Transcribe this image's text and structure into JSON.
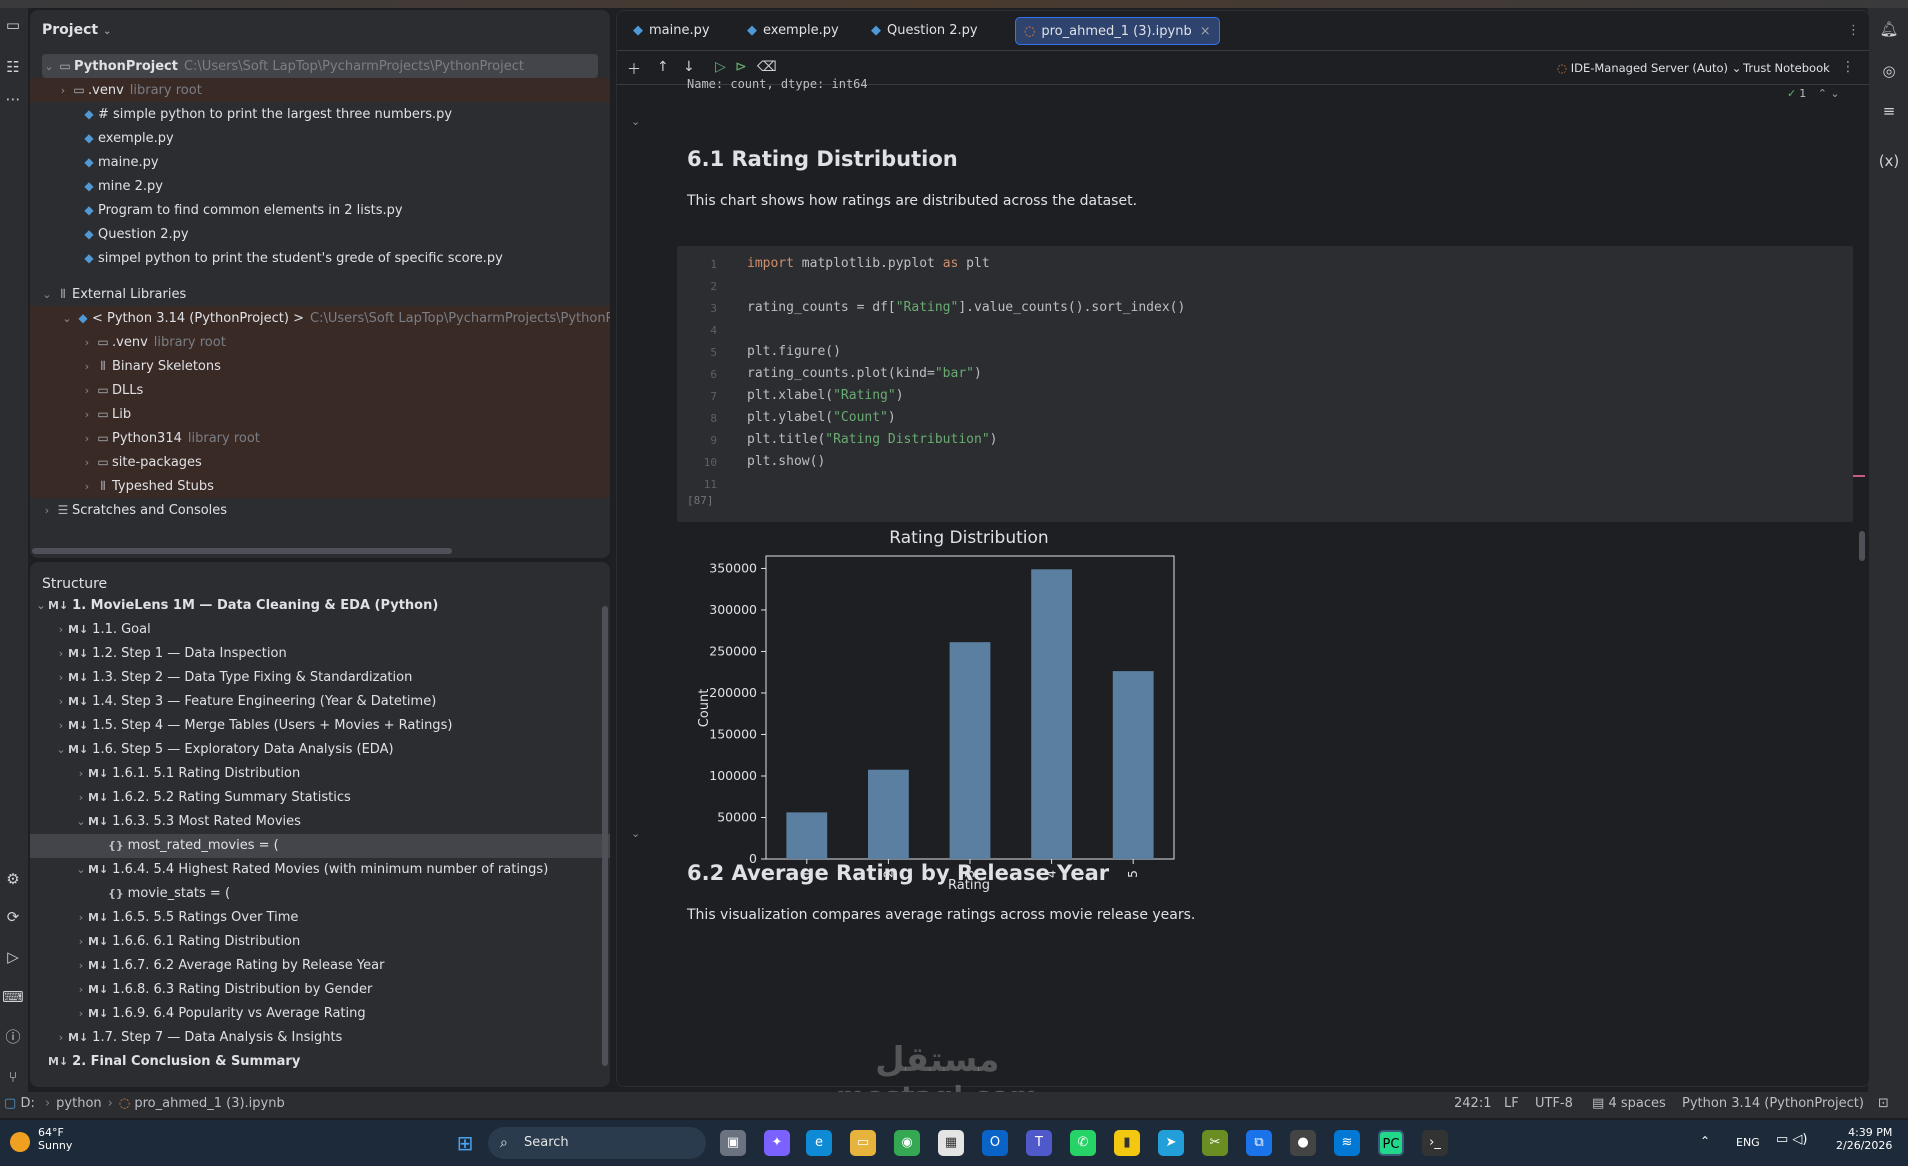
{
  "project_panel": {
    "title": "Project",
    "root": {
      "name": "PythonProject",
      "path": "C:\\Users\\Soft LapTop\\PycharmProjects\\PythonProject"
    },
    "venv": {
      "name": ".venv",
      "tag": "library root"
    },
    "files": [
      "# simple python to print the largest three numbers.py",
      "exemple.py",
      "maine.py",
      "mine 2.py",
      "Program to find common elements in 2 lists.py",
      "Question 2.py",
      "simpel python to print the student's grede of specific score.py"
    ],
    "external_libraries": "External Libraries",
    "python_sdk": {
      "name": "< Python 3.14 (PythonProject) >",
      "path": "C:\\Users\\Soft LapTop\\PycharmProjects\\PythonP"
    },
    "sdk_children": [
      {
        "name": ".venv",
        "tag": "library root"
      },
      {
        "name": "Binary Skeletons",
        "tag": ""
      },
      {
        "name": "DLLs",
        "tag": ""
      },
      {
        "name": "Lib",
        "tag": ""
      },
      {
        "name": "Python314",
        "tag": "library root"
      },
      {
        "name": "site-packages",
        "tag": ""
      },
      {
        "name": "Typeshed Stubs",
        "tag": ""
      }
    ],
    "scratches": "Scratches and Consoles"
  },
  "structure_panel": {
    "title": "Structure",
    "items": [
      {
        "label": "1. MovieLens 1M — Data Cleaning & EDA (Python)",
        "level": 0,
        "open": true
      },
      {
        "label": "1.1. Goal",
        "level": 1,
        "open": false
      },
      {
        "label": "1.2. Step 1 — Data Inspection",
        "level": 1,
        "open": false
      },
      {
        "label": "1.3. Step 2 — Data Type Fixing & Standardization",
        "level": 1,
        "open": false
      },
      {
        "label": "1.4. Step 3 — Feature Engineering (Year & Datetime)",
        "level": 1,
        "open": false
      },
      {
        "label": "1.5. Step 4 — Merge Tables (Users + Movies + Ratings)",
        "level": 1,
        "open": false
      },
      {
        "label": "1.6. Step 5 — Exploratory Data Analysis (EDA)",
        "level": 1,
        "open": true
      },
      {
        "label": "1.6.1. 5.1 Rating Distribution",
        "level": 2,
        "open": false
      },
      {
        "label": "1.6.2. 5.2 Rating Summary Statistics",
        "level": 2,
        "open": false
      },
      {
        "label": "1.6.3. 5.3 Most Rated Movies",
        "level": 2,
        "open": true
      },
      {
        "label": "most_rated_movies = (",
        "level": 3,
        "code": true
      },
      {
        "label": "1.6.4. 5.4 Highest Rated Movies (with minimum number of ratings)",
        "level": 2,
        "open": true
      },
      {
        "label": "movie_stats = (",
        "level": 3,
        "code": true
      },
      {
        "label": "1.6.5. 5.5 Ratings Over Time",
        "level": 2,
        "open": false
      },
      {
        "label": "1.6.6. 6.1 Rating Distribution",
        "level": 2,
        "open": false
      },
      {
        "label": "1.6.7. 6.2 Average Rating by Release Year",
        "level": 2,
        "open": false
      },
      {
        "label": "1.6.8. 6.3 Rating Distribution by Gender",
        "level": 2,
        "open": false
      },
      {
        "label": "1.6.9. 6.4 Popularity vs Average Rating",
        "level": 2,
        "open": false
      },
      {
        "label": "1.7. Step 7 — Data Analysis & Insights",
        "level": 1,
        "open": false
      },
      {
        "label": "2. Final Conclusion & Summary",
        "level": 0,
        "open": null
      }
    ],
    "md_badge": "M↓"
  },
  "tabs": [
    {
      "label": "maine.py",
      "active": false
    },
    {
      "label": "exemple.py",
      "active": false
    },
    {
      "label": "Question 2.py",
      "active": false
    },
    {
      "label": "pro_ahmed_1 (3).ipynb",
      "active": true
    }
  ],
  "toolbar": {
    "server": "IDE-Managed Server (Auto)",
    "trust": "Trust Notebook",
    "check_count": "1"
  },
  "notebook": {
    "prev_output": "Name: count, dtype: int64",
    "section1_title": "6.1 Rating Distribution",
    "section1_text": "This chart shows how ratings are distributed across the dataset.",
    "code_lines": [
      "import matplotlib.pyplot as plt",
      "",
      "rating_counts = df[\"Rating\"].value_counts().sort_index()",
      "",
      "plt.figure()",
      "rating_counts.plot(kind=\"bar\")",
      "plt.xlabel(\"Rating\")",
      "plt.ylabel(\"Count\")",
      "plt.title(\"Rating Distribution\")",
      "plt.show()",
      ""
    ],
    "exec_count": "[87]",
    "section2_title": "6.2 Average Rating by Release Year",
    "section2_text": "This visualization compares average ratings across movie release years."
  },
  "chart_data": {
    "type": "bar",
    "title": "Rating Distribution",
    "xlabel": "Rating",
    "ylabel": "Count",
    "categories": [
      "1",
      "2",
      "3",
      "4",
      "5"
    ],
    "values": [
      56174,
      107557,
      261197,
      348971,
      226310
    ],
    "ylim": [
      0,
      365000
    ],
    "yticks": [
      0,
      50000,
      100000,
      150000,
      200000,
      250000,
      300000,
      350000
    ],
    "bar_color": "#5a7fa0",
    "grid": false
  },
  "status_bar": {
    "drive": "D:",
    "crumb1": "python",
    "crumb2": "pro_ahmed_1 (3).ipynb",
    "position": "242:1",
    "line_sep": "LF",
    "encoding": "UTF-8",
    "indent": "4 spaces",
    "interpreter": "Python 3.14 (PythonProject)"
  },
  "taskbar": {
    "weather_temp": "64°F",
    "weather_desc": "Sunny",
    "search": "Search",
    "lang": "ENG",
    "time": "4:39 PM",
    "date": "2/26/2026"
  },
  "watermark": {
    "arabic": "مستقل",
    "latin": "mostaql.com"
  }
}
